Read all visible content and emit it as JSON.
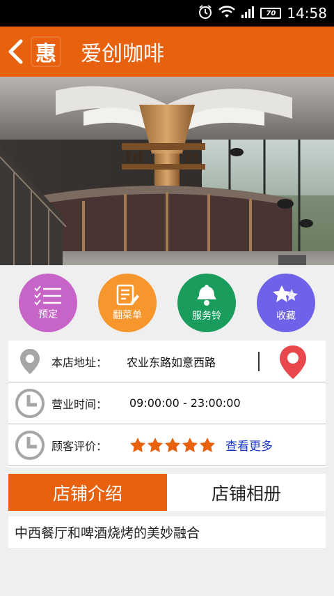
{
  "status_bar": {
    "time": "14:58",
    "battery": "70"
  },
  "header": {
    "logo_char": "惠",
    "title": "爱创咖啡"
  },
  "actions": [
    {
      "label": "预定",
      "color": "#c764c8"
    },
    {
      "label": "翻菜单",
      "color": "#f7962c"
    },
    {
      "label": "服务铃",
      "color": "#1a9c5d"
    },
    {
      "label": "收藏",
      "color": "#6e62e8"
    }
  ],
  "info": {
    "address_label": "本店地址：",
    "address_value": "农业东路如意西路",
    "hours_label": "营业时间：",
    "hours_value": "09:00:00 - 23:00:00",
    "rating_label": "顾客评价：",
    "rating_stars": 5,
    "more_link": "查看更多"
  },
  "tabs": [
    {
      "label": "店铺介绍"
    },
    {
      "label": "店铺相册"
    }
  ],
  "description": "中西餐厅和啤酒烧烤的美妙融合",
  "colors": {
    "accent": "#e8610f",
    "link": "#1a38c8",
    "star": "#e8610f",
    "pin": "#e8474c"
  }
}
